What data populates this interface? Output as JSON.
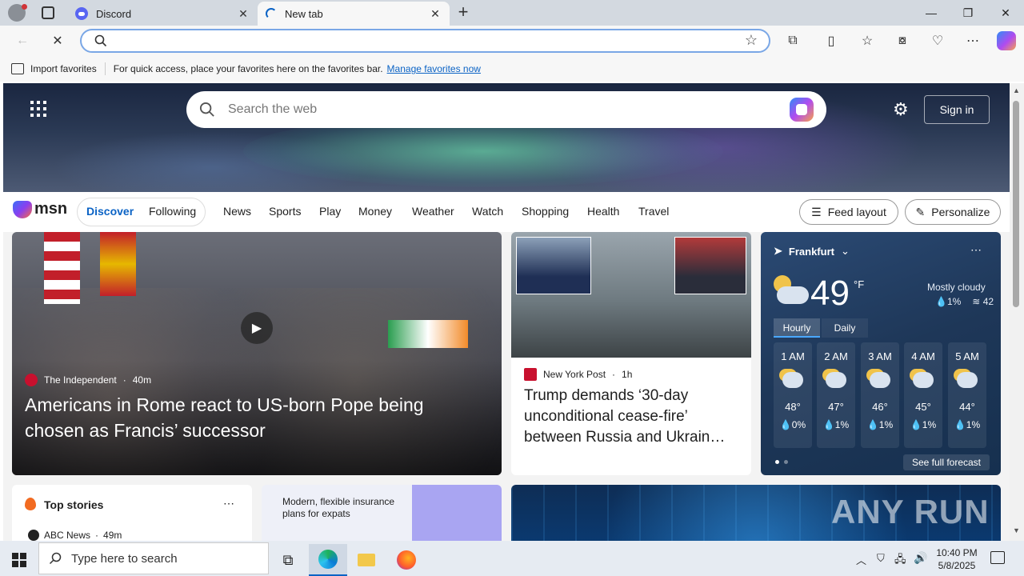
{
  "browser": {
    "tabs": [
      {
        "title": "Discord"
      },
      {
        "title": "New tab"
      }
    ],
    "address": {
      "value": "",
      "placeholder": ""
    }
  },
  "favbar": {
    "import_label": "Import favorites",
    "message": "For quick access, place your favorites here on the favorites bar.",
    "manage_link": "Manage favorites now"
  },
  "msn": {
    "search_placeholder": "Search the web",
    "signin_label": "Sign in",
    "logo": "msn",
    "nav": {
      "discover": "Discover",
      "following": "Following",
      "links": [
        "News",
        "Sports",
        "Play",
        "Money",
        "Weather",
        "Watch",
        "Shopping",
        "Health",
        "Travel"
      ],
      "feed_layout": "Feed layout",
      "personalize": "Personalize"
    },
    "main_story": {
      "source": "The Independent",
      "age": "40m",
      "headline": "Americans in Rome react to US-born Pope being chosen as Francis’ successor"
    },
    "story2": {
      "source": "New York Post",
      "age": "1h",
      "headline": "Trump demands ‘30-day unconditional cease-fire’ between Russia and Ukrain…"
    },
    "weather": {
      "city": "Frankfurt",
      "temp": "49",
      "unit": "°F",
      "condition": "Mostly cloudy",
      "precip": "1%",
      "aqi": "42",
      "tab_hourly": "Hourly",
      "tab_daily": "Daily",
      "hours": [
        {
          "time": "1 AM",
          "temp": "48°",
          "precip": "0%"
        },
        {
          "time": "2 AM",
          "temp": "47°",
          "precip": "1%"
        },
        {
          "time": "3 AM",
          "temp": "46°",
          "precip": "1%"
        },
        {
          "time": "4 AM",
          "temp": "45°",
          "precip": "1%"
        },
        {
          "time": "5 AM",
          "temp": "44°",
          "precip": "1%"
        }
      ],
      "forecast_link": "See full forecast"
    },
    "top_stories": {
      "title": "Top stories",
      "first_source": "ABC News",
      "first_age": "49m"
    },
    "insurance": {
      "text": "Modern, flexible insurance plans for expats"
    },
    "ad_watermark": "ANY RUN"
  },
  "taskbar": {
    "search_placeholder": "Type here to search",
    "time": "10:40 PM",
    "date": "5/8/2025"
  }
}
